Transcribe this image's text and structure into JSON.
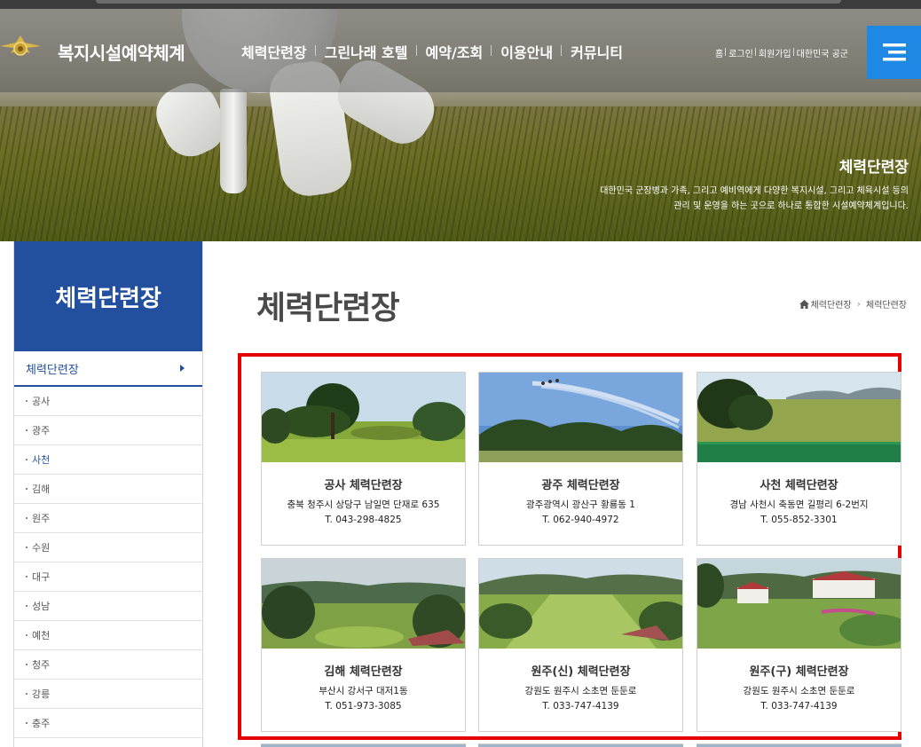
{
  "header": {
    "site_title": "복지시설예약체계",
    "menu": [
      "체력단련장",
      "그린나래 호텔",
      "예약/조회",
      "이용안내",
      "커뮤니티"
    ],
    "util_links": [
      "홈",
      "로그인",
      "회원가입",
      "대한민국 공군"
    ]
  },
  "hero": {
    "title": "체력단련장",
    "desc_line1": "대한민국 군장병과 가족, 그리고 예비역에게 다양한 복지시설, 그리고 체육시설 등의",
    "desc_line2": "관리 및 운영을 하는 곳으로 하나로 통합한 시설예약체계입니다."
  },
  "sidebar": {
    "title": "체력단련장",
    "active": "체력단련장",
    "items": [
      "공사",
      "광주",
      "사천",
      "김해",
      "원주",
      "수원",
      "대구",
      "성남",
      "예천",
      "청주",
      "강릉",
      "충주"
    ],
    "current_item": "사천"
  },
  "main": {
    "page_title": "체력단련장",
    "breadcrumb": [
      "체력단련장",
      "체력단련장"
    ]
  },
  "cards": [
    {
      "name": "공사 체력단련장",
      "address": "충북 청주시 상당구 남일면 단재로 635",
      "tel": "T. 043-298-4825"
    },
    {
      "name": "광주 체력단련장",
      "address": "광주광역시 광산구 황룡동 1",
      "tel": "T. 062-940-4972"
    },
    {
      "name": "사천 체력단련장",
      "address": "경남 사천시 축동면 길평리 6-2번지",
      "tel": "T. 055-852-3301"
    },
    {
      "name": "김해 체력단련장",
      "address": "부산시 강서구 대저1동",
      "tel": "T. 051-973-3085"
    },
    {
      "name": "원주(신) 체력단련장",
      "address": "강원도 원주시 소초면 둔둔로",
      "tel": "T. 033-747-4139"
    },
    {
      "name": "원주(구) 체력단련장",
      "address": "강원도 원주시 소초면 둔둔로",
      "tel": "T. 033-747-4139"
    }
  ],
  "colors": {
    "brand_blue": "#224f9e",
    "menu_button": "#1e88e5",
    "highlight_border": "#e60000"
  },
  "icons": [
    "emblem-logo",
    "hamburger-menu-icon",
    "home-icon",
    "chevron-right-icon"
  ]
}
